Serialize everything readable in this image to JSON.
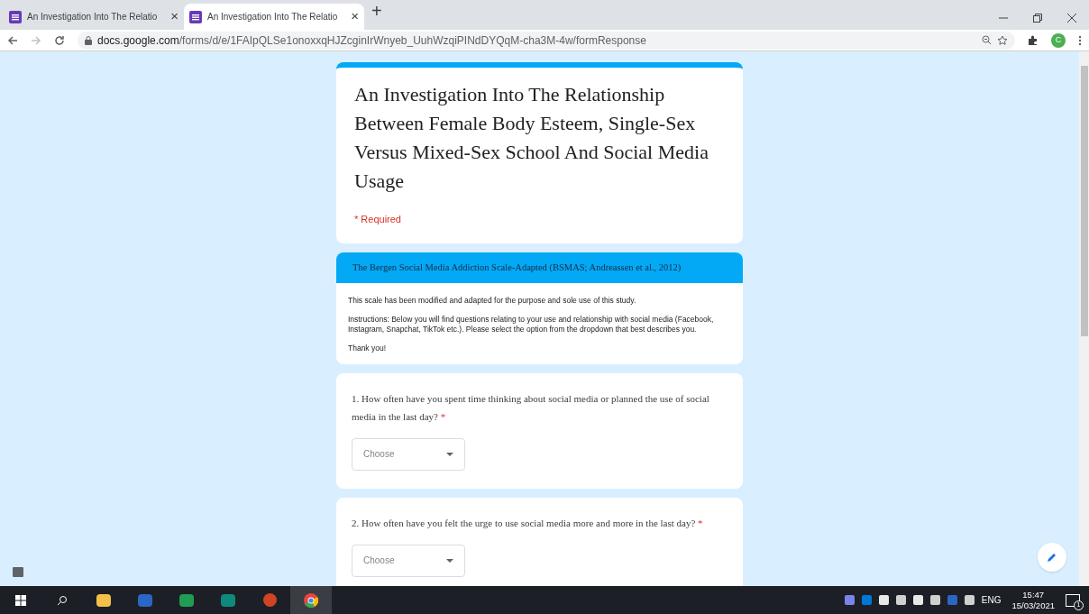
{
  "browser": {
    "tabs": [
      {
        "title": "An Investigation Into The Relatio",
        "close": "×",
        "selected": false
      },
      {
        "title": "An Investigation Into The Relatio",
        "close": "×",
        "selected": true
      }
    ],
    "new_tab": "+",
    "url": {
      "host": "docs.google.com",
      "path": "/forms/d/e/1FAIpQLSe1onoxxqHJZcginIrWnyeb_UuhWzqiPINdDYQqM-cha3M-4w/formResponse"
    },
    "profile": "C"
  },
  "form": {
    "title": "An Investigation Into The Relationship Between Female Body Esteem, Single-Sex Versus Mixed-Sex School And Social Media Usage",
    "required_note": "* Required",
    "section": {
      "title": "The Bergen Social Media Addiction Scale-Adapted (BSMAS; Andreassen et al., 2012)",
      "paragraphs": [
        "This scale has been modified and adapted for the purpose and sole use of this study.",
        "Instructions: Below you will find questions relating to your use and relationship with social media (Facebook, Instagram, Snapchat, TikTok etc.). Please select the option from the dropdown that best describes you.",
        "Thank you!"
      ]
    },
    "questions": [
      {
        "text": "1. How often have you spent time thinking about social media or planned the use of social media in the last day?",
        "required_mark": "*",
        "dropdown": "Choose"
      },
      {
        "text": "2. How often have you felt the urge to use social media more and more in the last day?",
        "required_mark": "*",
        "dropdown": "Choose"
      }
    ]
  },
  "taskbar": {
    "language": "ENG",
    "time": "15:47",
    "date": "15/03/2021",
    "notifications": "1"
  }
}
